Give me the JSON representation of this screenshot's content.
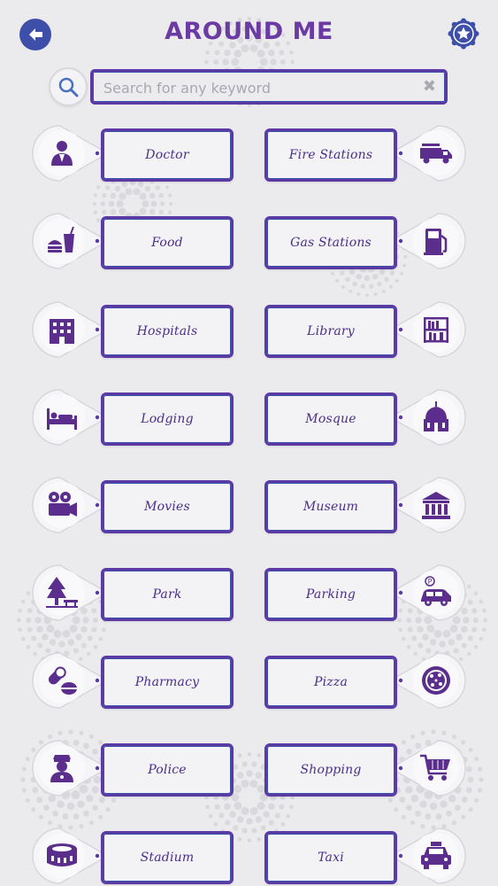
{
  "header": {
    "title": "AROUND ME",
    "back_icon": "back-arrow-icon",
    "favorite_icon": "star-badge-icon"
  },
  "search": {
    "placeholder": "Search for any keyword",
    "value": "",
    "search_icon": "search-icon",
    "clear_icon": "clear-icon",
    "clear_glyph": "✖"
  },
  "categories": [
    {
      "label": "Doctor",
      "icon": "doctor-icon",
      "side": "left"
    },
    {
      "label": "Fire Stations",
      "icon": "fire-truck-icon",
      "side": "right"
    },
    {
      "label": "Food",
      "icon": "food-icon",
      "side": "left"
    },
    {
      "label": "Gas Stations",
      "icon": "gas-pump-icon",
      "side": "right"
    },
    {
      "label": "Hospitals",
      "icon": "hospital-icon",
      "side": "left"
    },
    {
      "label": "Library",
      "icon": "bookshelf-icon",
      "side": "right"
    },
    {
      "label": "Lodging",
      "icon": "bed-icon",
      "side": "left"
    },
    {
      "label": "Mosque",
      "icon": "mosque-icon",
      "side": "right"
    },
    {
      "label": "Movies",
      "icon": "film-camera-icon",
      "side": "left"
    },
    {
      "label": "Museum",
      "icon": "museum-icon",
      "side": "right"
    },
    {
      "label": "Park",
      "icon": "park-tree-icon",
      "side": "left"
    },
    {
      "label": "Parking",
      "icon": "parking-car-icon",
      "side": "right"
    },
    {
      "label": "Pharmacy",
      "icon": "pills-icon",
      "side": "left"
    },
    {
      "label": "Pizza",
      "icon": "pizza-icon",
      "side": "right"
    },
    {
      "label": "Police",
      "icon": "police-officer-icon",
      "side": "left"
    },
    {
      "label": "Shopping",
      "icon": "shopping-cart-icon",
      "side": "right"
    },
    {
      "label": "Stadium",
      "icon": "stadium-icon",
      "side": "left"
    },
    {
      "label": "Taxi",
      "icon": "taxi-icon",
      "side": "right"
    }
  ],
  "colors": {
    "accent_purple": "#5a3aa5",
    "accent_blue": "#3d4fa8",
    "title_purple": "#6b3aa3",
    "background": "#ebebed"
  }
}
